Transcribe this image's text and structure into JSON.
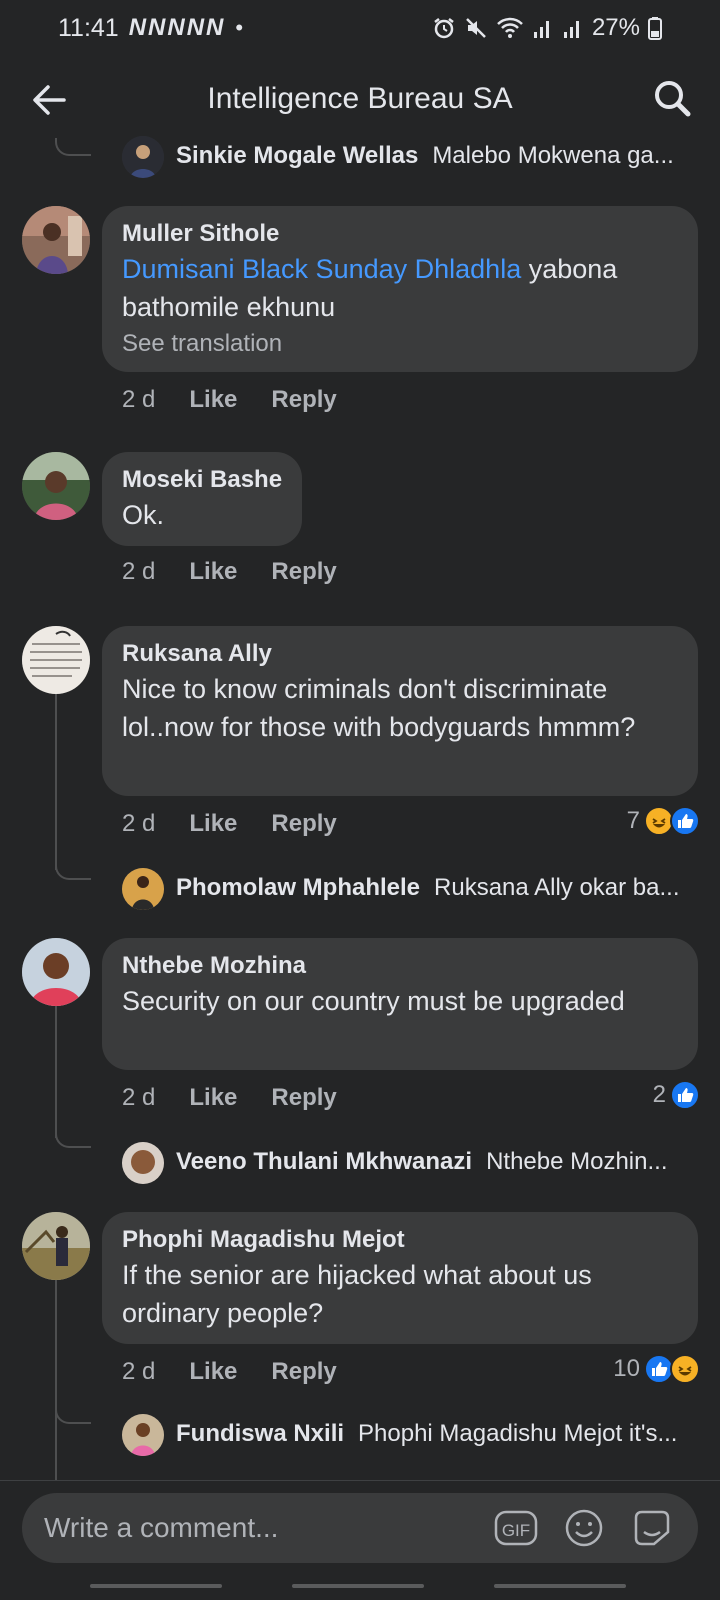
{
  "status": {
    "time": "11:41",
    "network_marks": "NNNNN",
    "dot": "•",
    "battery": "27%"
  },
  "header": {
    "title": "Intelligence Bureau SA"
  },
  "comments": [
    {
      "reply_preview": {
        "name": "Sinkie Mogale Wellas",
        "text": "Malebo Mokwena ga..."
      }
    },
    {
      "name": "Muller Sithole",
      "mention": "Dumisani Black Sunday Dhladhla",
      "text": " yabona bathomile ekhunu",
      "translate": "See translation",
      "time": "2 d",
      "like": "Like",
      "reply": "Reply"
    },
    {
      "name": "Moseki Bashe",
      "text": "Ok.",
      "time": "2 d",
      "like": "Like",
      "reply": "Reply"
    },
    {
      "name": "Ruksana Ally",
      "text": "Nice to know criminals don't discriminate lol..now for those with bodyguards hmmm?",
      "time": "2 d",
      "like": "Like",
      "reply": "Reply",
      "reaction_count": "7",
      "reply_preview": {
        "name": "Phomolaw Mphahlele",
        "text": "Ruksana Ally okar ba..."
      }
    },
    {
      "name": "Nthebe Mozhina",
      "text": "Security on our country must be upgraded",
      "time": "2 d",
      "like": "Like",
      "reply": "Reply",
      "reaction_count": "2",
      "reply_preview": {
        "name": "Veeno Thulani Mkhwanazi",
        "text": "Nthebe Mozhin..."
      }
    },
    {
      "name": "Phophi Magadishu Mejot",
      "text": "If the senior are hijacked what about us ordinary people?",
      "time": "2 d",
      "like": "Like",
      "reply": "Reply",
      "reaction_count": "10",
      "reply_preview": {
        "name": "Fundiswa Nxili",
        "text": "Phophi Magadishu Mejot it's..."
      }
    }
  ],
  "composer": {
    "placeholder": "Write a comment...",
    "gif_label": "GIF"
  },
  "colors": {
    "background": "#242526",
    "bubble": "#3a3b3c",
    "mention": "#4599ff",
    "like_blue": "#1877f2",
    "haha_yellow": "#f7b125"
  },
  "icons": [
    "back-arrow-icon",
    "search-icon",
    "alarm-icon",
    "mute-icon",
    "wifi-icon",
    "signal-icon",
    "battery-icon",
    "like-reaction-icon",
    "haha-reaction-icon",
    "gif-icon",
    "emoji-icon",
    "sticker-icon"
  ]
}
